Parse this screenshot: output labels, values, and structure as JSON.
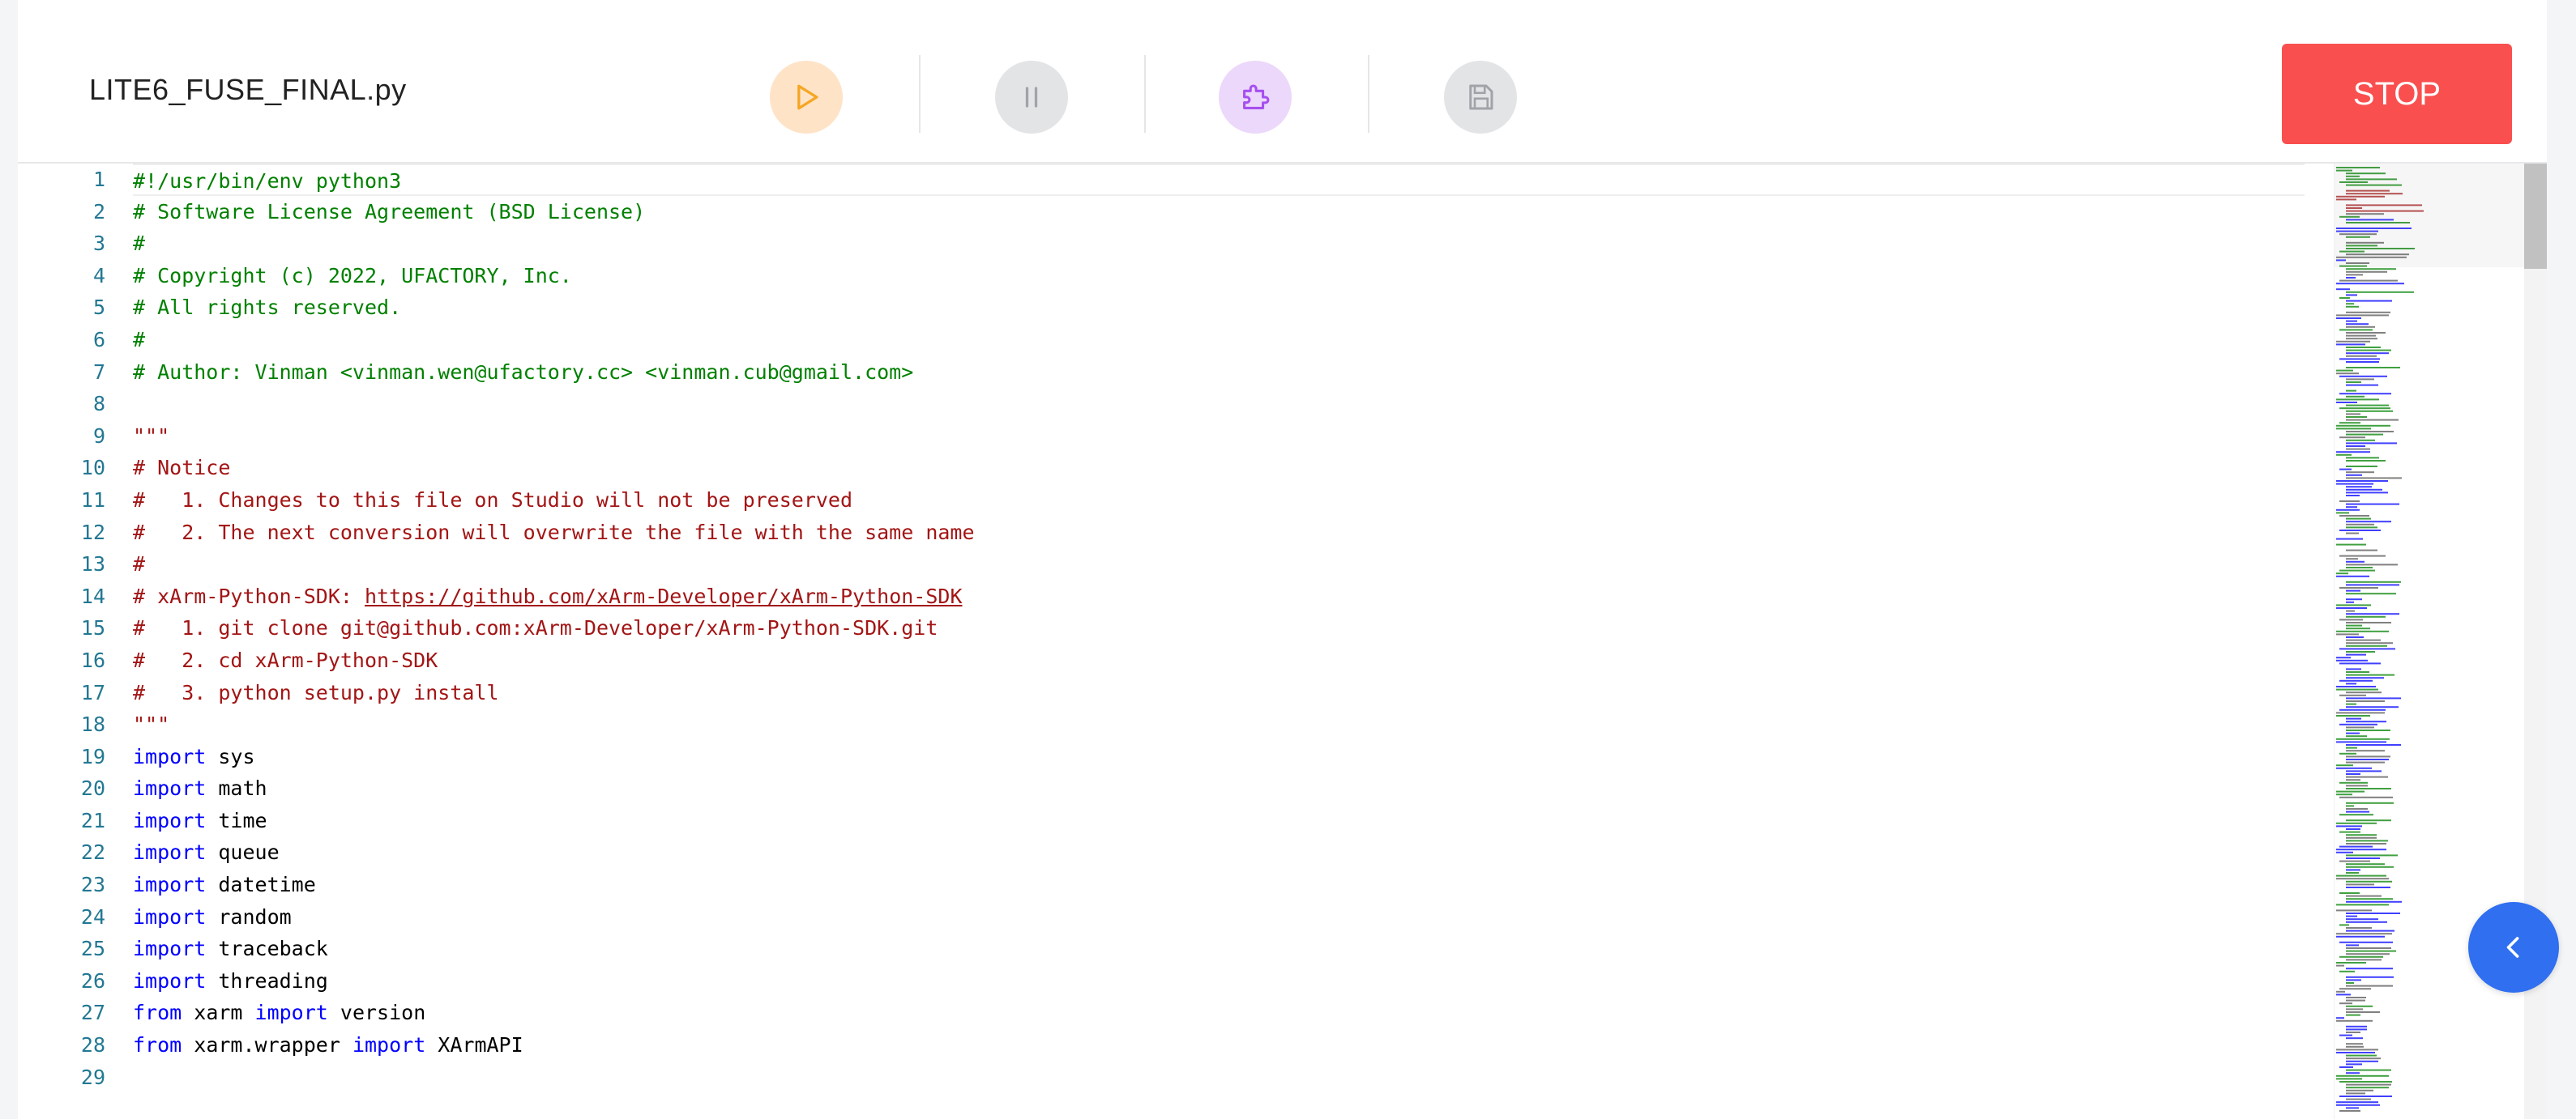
{
  "toolbar": {
    "file_name": "LITE6_FUSE_FINAL.py",
    "run_icon": "play-icon",
    "pause_icon": "pause-icon",
    "blockly_icon": "puzzle-icon",
    "save_icon": "save-icon",
    "stop_label": "STOP"
  },
  "colors": {
    "stop": "#fa4f4f",
    "run_bg": "#ffe3c7",
    "run_icon": "#f5a623",
    "blockly_bg": "#ecd8fa",
    "blockly_icon": "#a64ff0",
    "disabled_bg": "#e3e4e6",
    "disabled_icon": "#a0a3a8",
    "collapse": "#2f6ff0",
    "comment": "#008000",
    "string": "#a31515",
    "keyword": "#0000ff",
    "line_number": "#237893"
  },
  "editor": {
    "lines": [
      {
        "n": "1",
        "tokens": [
          {
            "t": "#!/usr/bin/env python3",
            "c": "comment"
          }
        ]
      },
      {
        "n": "2",
        "tokens": [
          {
            "t": "# Software License Agreement (BSD License)",
            "c": "comment"
          }
        ]
      },
      {
        "n": "3",
        "tokens": [
          {
            "t": "#",
            "c": "comment"
          }
        ]
      },
      {
        "n": "4",
        "tokens": [
          {
            "t": "# Copyright (c) 2022, UFACTORY, Inc.",
            "c": "comment"
          }
        ]
      },
      {
        "n": "5",
        "tokens": [
          {
            "t": "# All rights reserved.",
            "c": "comment"
          }
        ]
      },
      {
        "n": "6",
        "tokens": [
          {
            "t": "#",
            "c": "comment"
          }
        ]
      },
      {
        "n": "7",
        "tokens": [
          {
            "t": "# Author: Vinman <vinman.wen@ufactory.cc> <vinman.cub@gmail.com>",
            "c": "comment"
          }
        ]
      },
      {
        "n": "8",
        "tokens": []
      },
      {
        "n": "9",
        "tokens": [
          {
            "t": "\"\"\"",
            "c": "string"
          }
        ]
      },
      {
        "n": "10",
        "tokens": [
          {
            "t": "# Notice",
            "c": "string"
          }
        ]
      },
      {
        "n": "11",
        "tokens": [
          {
            "t": "#   1. Changes to this file on Studio will not be preserved",
            "c": "string"
          }
        ]
      },
      {
        "n": "12",
        "tokens": [
          {
            "t": "#   2. The next conversion will overwrite the file with the same name",
            "c": "string"
          }
        ]
      },
      {
        "n": "13",
        "tokens": [
          {
            "t": "#",
            "c": "string"
          }
        ]
      },
      {
        "n": "14",
        "tokens": [
          {
            "t": "# xArm-Python-SDK: ",
            "c": "string"
          },
          {
            "t": "https://github.com/xArm-Developer/xArm-Python-SDK",
            "c": "link"
          }
        ]
      },
      {
        "n": "15",
        "tokens": [
          {
            "t": "#   1. git clone git@github.com:xArm-Developer/xArm-Python-SDK.git",
            "c": "string"
          }
        ]
      },
      {
        "n": "16",
        "tokens": [
          {
            "t": "#   2. cd xArm-Python-SDK",
            "c": "string"
          }
        ]
      },
      {
        "n": "17",
        "tokens": [
          {
            "t": "#   3. python setup.py install",
            "c": "string"
          }
        ]
      },
      {
        "n": "18",
        "tokens": [
          {
            "t": "\"\"\"",
            "c": "string"
          }
        ]
      },
      {
        "n": "19",
        "tokens": [
          {
            "t": "import",
            "c": "kw"
          },
          {
            "t": " sys",
            "c": "plain"
          }
        ]
      },
      {
        "n": "20",
        "tokens": [
          {
            "t": "import",
            "c": "kw"
          },
          {
            "t": " math",
            "c": "plain"
          }
        ]
      },
      {
        "n": "21",
        "tokens": [
          {
            "t": "import",
            "c": "kw"
          },
          {
            "t": " time",
            "c": "plain"
          }
        ]
      },
      {
        "n": "22",
        "tokens": [
          {
            "t": "import",
            "c": "kw"
          },
          {
            "t": " queue",
            "c": "plain"
          }
        ]
      },
      {
        "n": "23",
        "tokens": [
          {
            "t": "import",
            "c": "kw"
          },
          {
            "t": " datetime",
            "c": "plain"
          }
        ]
      },
      {
        "n": "24",
        "tokens": [
          {
            "t": "import",
            "c": "kw"
          },
          {
            "t": " random",
            "c": "plain"
          }
        ]
      },
      {
        "n": "25",
        "tokens": [
          {
            "t": "import",
            "c": "kw"
          },
          {
            "t": " traceback",
            "c": "plain"
          }
        ]
      },
      {
        "n": "26",
        "tokens": [
          {
            "t": "import",
            "c": "kw"
          },
          {
            "t": " threading",
            "c": "plain"
          }
        ]
      },
      {
        "n": "27",
        "tokens": [
          {
            "t": "from",
            "c": "kw"
          },
          {
            "t": " xarm ",
            "c": "plain"
          },
          {
            "t": "import",
            "c": "kw"
          },
          {
            "t": " version",
            "c": "plain"
          }
        ]
      },
      {
        "n": "28",
        "tokens": [
          {
            "t": "from",
            "c": "kw"
          },
          {
            "t": " xarm.wrapper ",
            "c": "plain"
          },
          {
            "t": "import",
            "c": "kw"
          },
          {
            "t": " XArmAPI",
            "c": "plain"
          }
        ]
      },
      {
        "n": "29",
        "tokens": []
      }
    ],
    "minimap_icon": "minimap",
    "collapse_icon": "chevron-left-icon"
  }
}
